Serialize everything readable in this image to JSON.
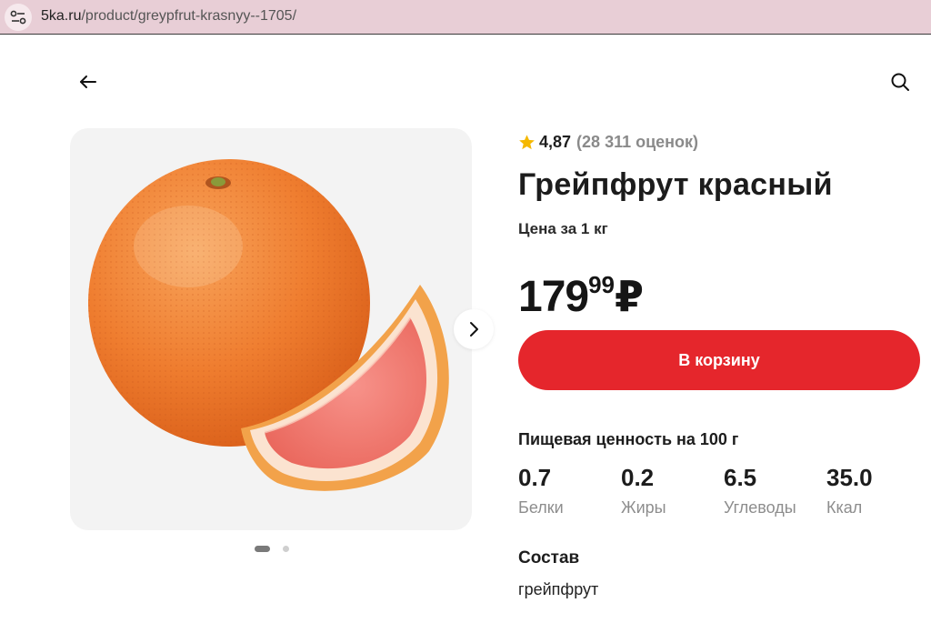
{
  "browser": {
    "url_host": "5ka.ru",
    "url_path": "/product/greypfrut-krasnyy--1705/"
  },
  "product": {
    "rating": "4,87",
    "ratings_count": "(28 311 оценок)",
    "title": "Грейпфрут красный",
    "unit": "Цена за 1 кг",
    "price_rub": "179",
    "price_kop": "99",
    "currency": "₽",
    "cart_button": "В корзину",
    "image_alt": "grapefruit-photo",
    "carousel": {
      "slides": 2,
      "active": 1
    }
  },
  "nutrition": {
    "title": "Пищевая ценность на 100 г",
    "items": [
      {
        "value": "0.7",
        "label": "Белки"
      },
      {
        "value": "0.2",
        "label": "Жиры"
      },
      {
        "value": "6.5",
        "label": "Углеводы"
      },
      {
        "value": "35.0",
        "label": "Ккал"
      }
    ]
  },
  "composition": {
    "title": "Состав",
    "text": "грейпфрут"
  },
  "colors": {
    "accent_red": "#e5262c",
    "star": "#f5b800",
    "urlbar_bg": "#e8ced6"
  }
}
